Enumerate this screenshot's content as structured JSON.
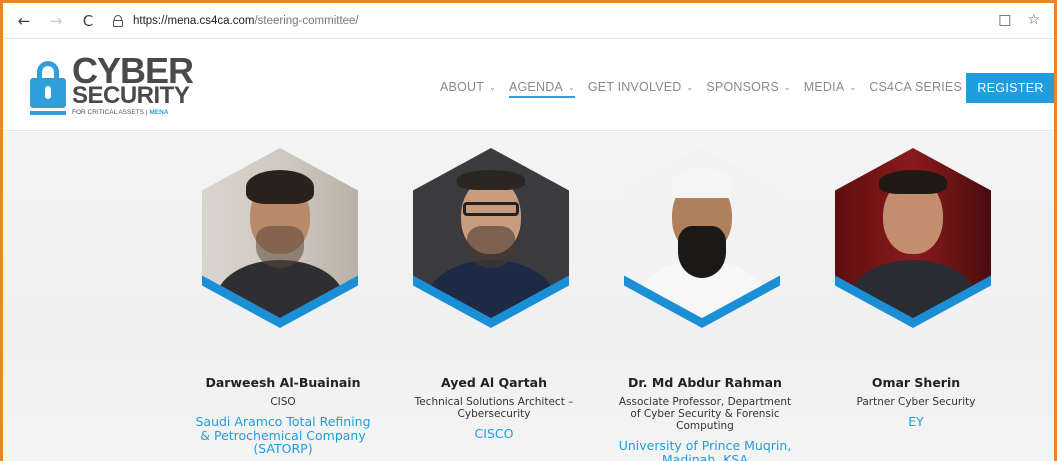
{
  "browser": {
    "back": "←",
    "forward": "→",
    "reload": "C",
    "url_host": "https://mena.cs4ca.com",
    "url_path": "/steering-committee/",
    "reader_icon": "□",
    "favorite_icon": "☆"
  },
  "logo": {
    "line1": "CYBER",
    "line2": "SECURITY",
    "tagline": "FOR CRITICAL ASSETS |",
    "tagline_region": "MENA"
  },
  "nav": {
    "items": [
      {
        "label": "ABOUT",
        "chevron": "⌄",
        "active": false
      },
      {
        "label": "AGENDA",
        "chevron": "⌄",
        "active": true
      },
      {
        "label": "GET INVOLVED",
        "chevron": "⌄",
        "active": false
      },
      {
        "label": "SPONSORS",
        "chevron": "⌄",
        "active": false
      },
      {
        "label": "MEDIA",
        "chevron": "⌄",
        "active": false
      },
      {
        "label": "CS4CA SERIES",
        "chevron": "",
        "active": false
      }
    ],
    "register_label": "REGISTER"
  },
  "colors": {
    "accent": "#1f9ddc",
    "text_dark": "#222222",
    "nav_text": "#8a8a8a"
  },
  "speakers": [
    {
      "name": "Darweesh Al-Buainain",
      "title": "CISO",
      "company": "Saudi Aramco Total Refining & Petrochemical Company (SATORP)"
    },
    {
      "name": "Ayed Al Qartah",
      "title": "Technical Solutions Architect – Cybersecurity",
      "company": "CISCO"
    },
    {
      "name": "Dr. Md Abdur Rahman",
      "title": "Associate Professor, Department of Cyber Security & Forensic Computing",
      "company": "University of Prince Muqrin, Madinah, KSA"
    },
    {
      "name": "Omar Sherin",
      "title": "Partner Cyber Security",
      "company": "EY"
    }
  ]
}
